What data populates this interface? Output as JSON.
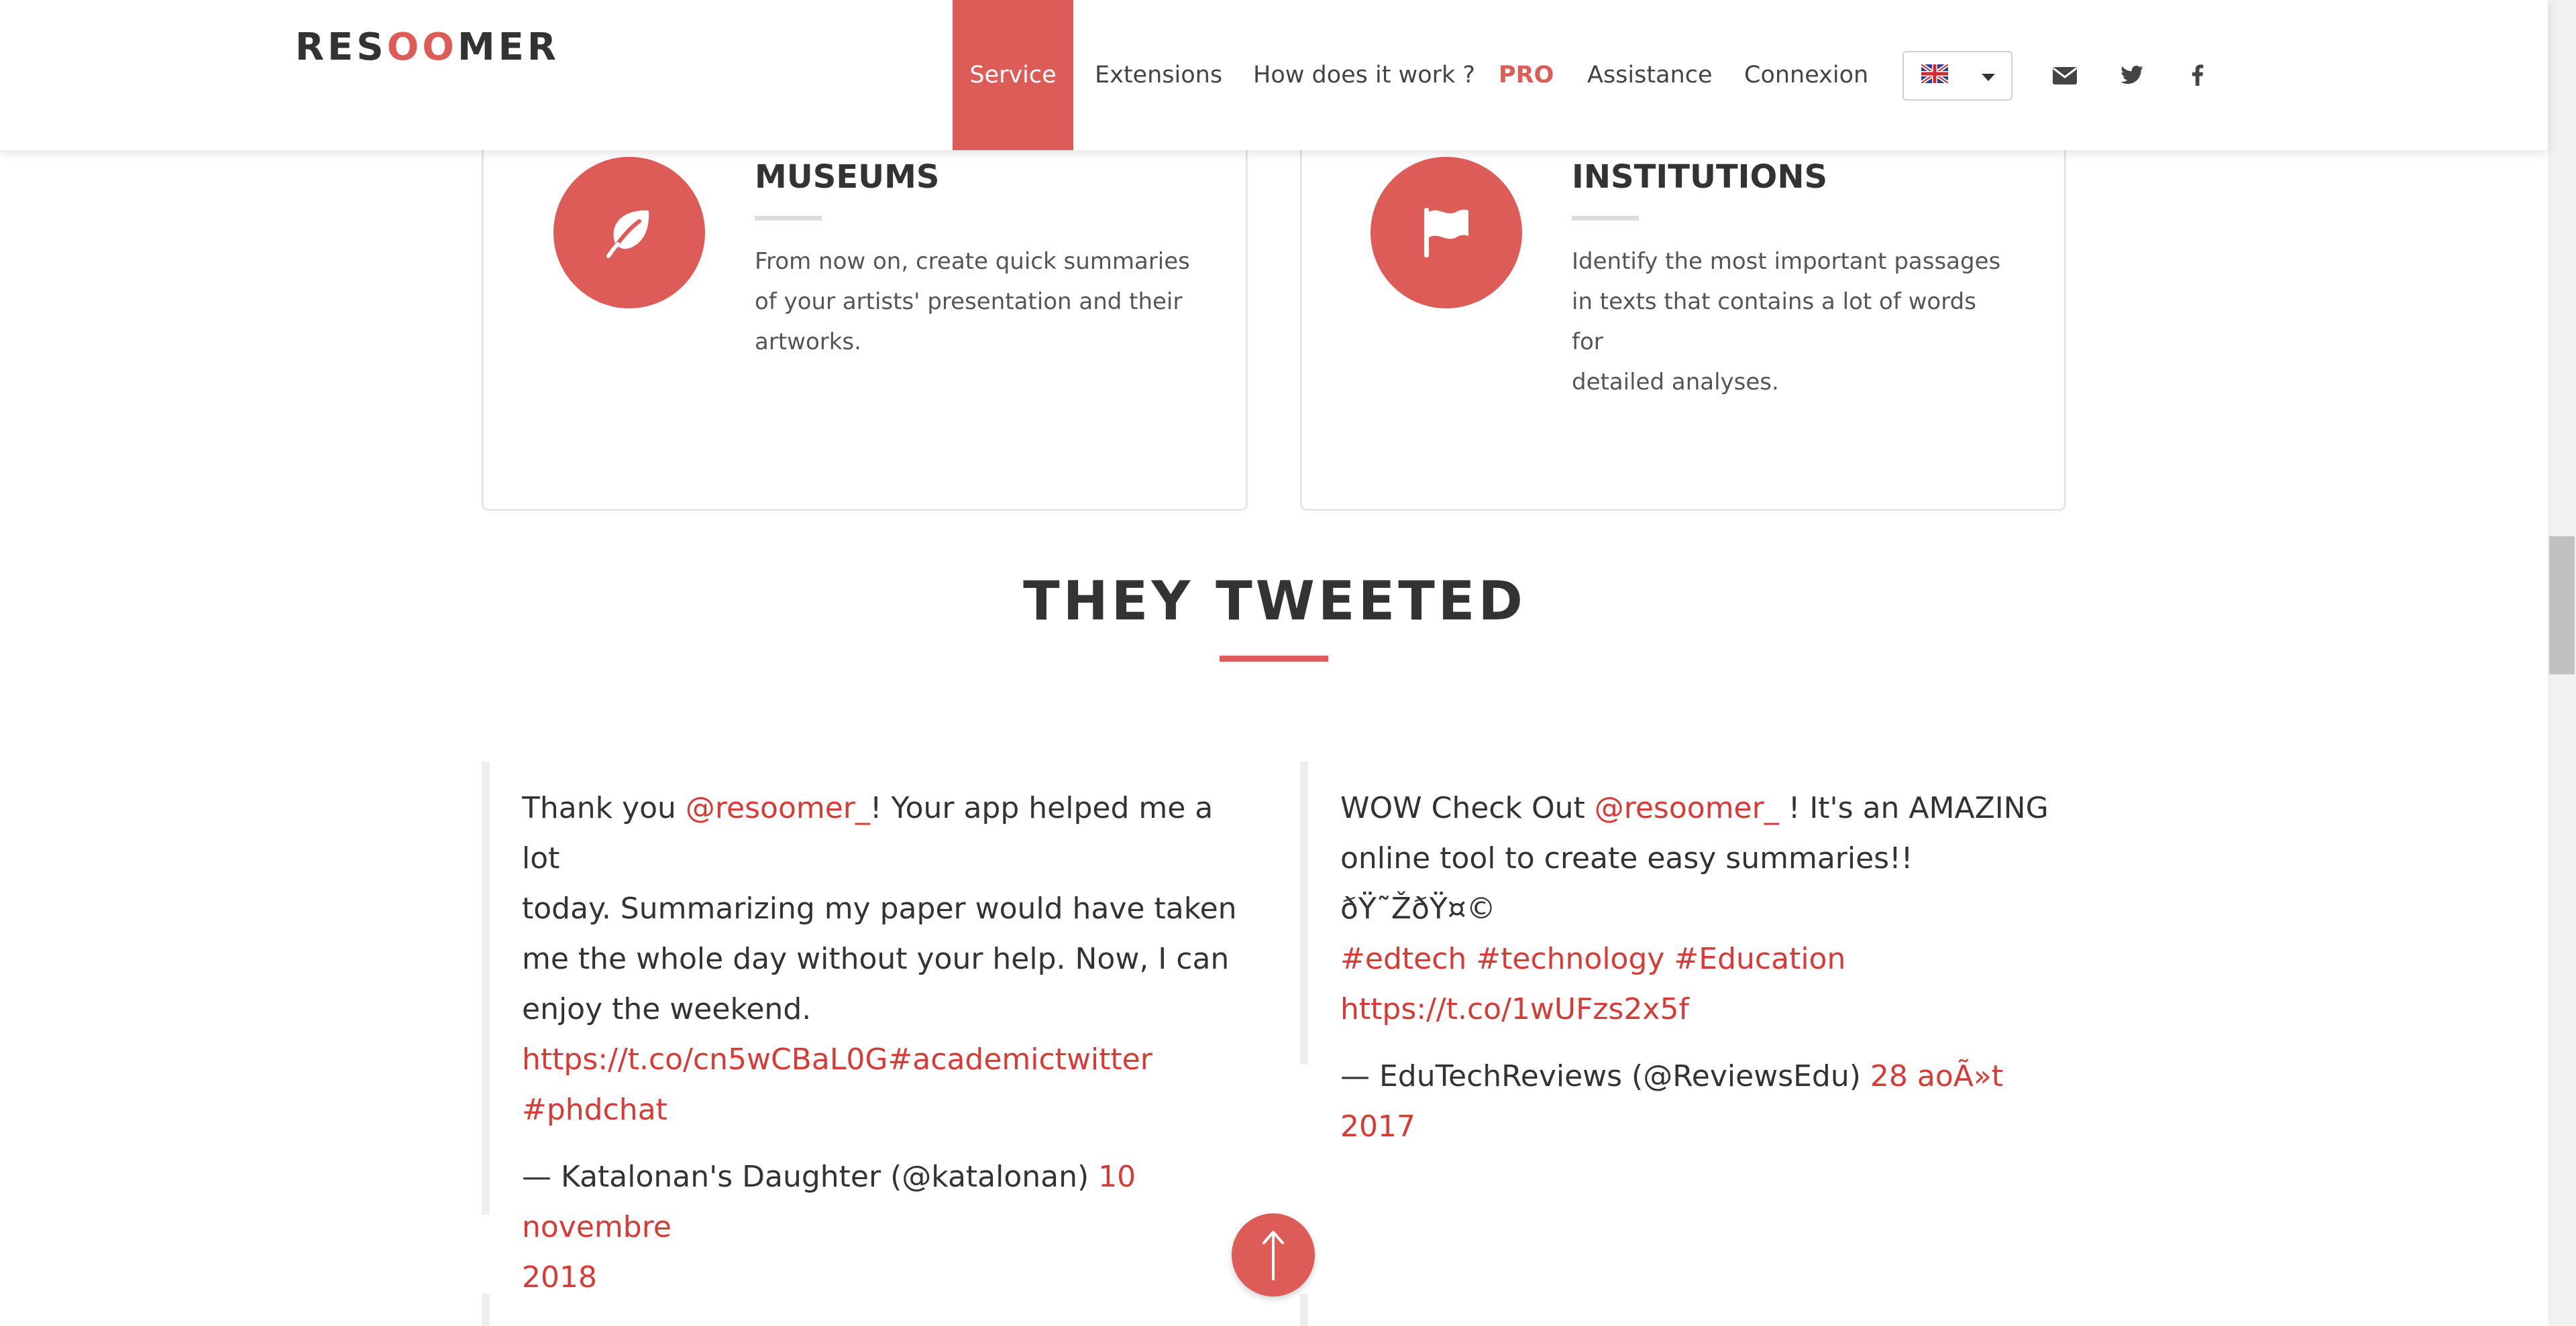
{
  "header": {
    "logo": {
      "part1": "RES",
      "part2": "OO",
      "part3": "MER"
    },
    "nav": {
      "service": "Service",
      "extensions": "Extensions",
      "how": "How does it work ?",
      "pro": "PRO",
      "assistance": "Assistance",
      "connexion": "Connexion"
    },
    "language_icon": "uk-flag-icon",
    "social_icons": [
      "envelope-icon",
      "twitter-icon",
      "facebook-icon"
    ]
  },
  "cards": [
    {
      "title": "MUSEUMS",
      "icon": "leaf-icon",
      "lines": [
        "From now on, create quick summaries",
        "of your artists' presentation and their",
        "artworks."
      ]
    },
    {
      "title": "INSTITUTIONS",
      "icon": "flag-icon",
      "lines": [
        "Identify the most important passages",
        "in texts that contains a lot of words for",
        "detailed analyses."
      ]
    }
  ],
  "section": {
    "title": "THEY TWEETED"
  },
  "tweets": [
    {
      "t1": "Thank you ",
      "mention": "@resoomer_",
      "t2": "! Your app helped me a lot",
      "line2": "today. Summarizing my paper would have taken",
      "line3": "me the whole day without your help. Now, I can",
      "line4": "enjoy the weekend.",
      "link1": "https://t.co/cn5wCBaL0G#academictwitter",
      "link2": "#phdchat",
      "author": "— Katalonan's Daughter (@katalonan) ",
      "date1": "10 novembre",
      "date2": "2018"
    },
    {
      "t1": "WOW Check Out ",
      "mention": "@resoomer_",
      "t2": " ! It's an AMAZING",
      "line2": "online tool to create easy summaries!! ðŸ˜ŽðŸ¤©",
      "tags": "#edtech #technology #Education",
      "link": "https://t.co/1wUFzs2x5f",
      "author": "— EduTechReviews (@ReviewsEdu) ",
      "date": "28 aoÃ»t 2017"
    }
  ],
  "colors": {
    "accent": "#dd5c58",
    "link": "#d83a36",
    "text": "#333333"
  }
}
